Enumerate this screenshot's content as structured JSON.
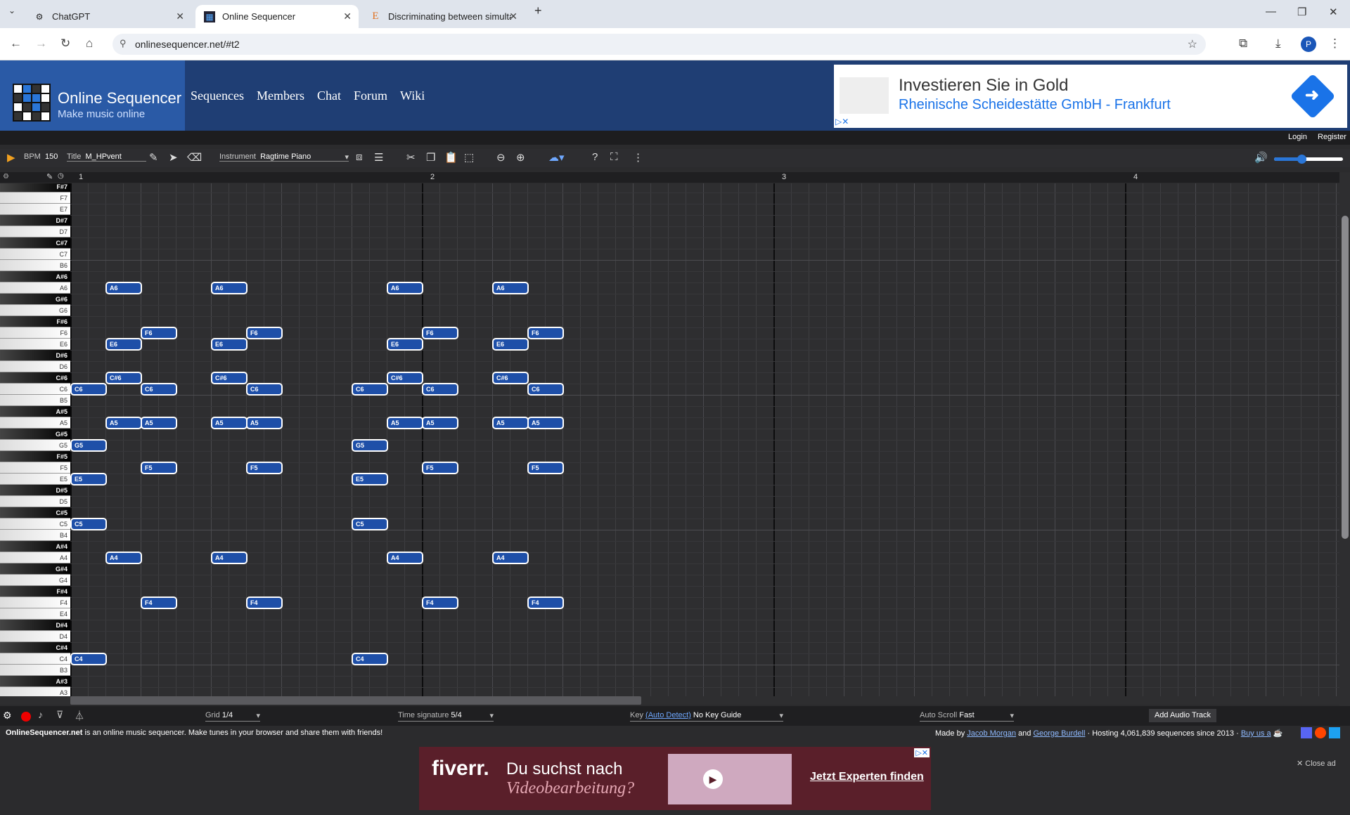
{
  "browser": {
    "tabs": [
      {
        "title": "ChatGPT",
        "icon": "chatgpt-icon"
      },
      {
        "title": "Online Sequencer",
        "icon": "sequencer-icon"
      },
      {
        "title": "Discriminating between simulta",
        "icon": "e-icon"
      }
    ],
    "url": "onlinesequencer.net/#t2",
    "profile_initial": "P"
  },
  "site": {
    "title": "Online Sequencer",
    "subtitle": "Make music online",
    "nav": [
      "Sequences",
      "Members",
      "Chat",
      "Forum",
      "Wiki"
    ],
    "login": "Login",
    "register": "Register"
  },
  "ad_top": {
    "line1": "Investieren Sie in Gold",
    "line2": "Rheinische Scheidestätte GmbH - Frankfurt"
  },
  "toolbar": {
    "bpm_label": "BPM",
    "bpm_value": "150",
    "title_label": "Title",
    "title_value": "M_HPvent",
    "instrument_label": "Instrument",
    "instrument_value": "Ragtime Piano",
    "volume": 0.4
  },
  "ruler": {
    "bars": [
      "1",
      "2",
      "3",
      "4"
    ]
  },
  "keys": [
    "F#7",
    "F7",
    "E7",
    "D#7",
    "D7",
    "C#7",
    "C7",
    "B6",
    "A#6",
    "A6",
    "G#6",
    "G6",
    "F#6",
    "F6",
    "E6",
    "D#6",
    "D6",
    "C#6",
    "C6",
    "B5",
    "A#5",
    "A5",
    "G#5",
    "G5",
    "F#5",
    "F5",
    "E5",
    "D#5",
    "D5",
    "C#5",
    "C5",
    "B4",
    "A#4",
    "A4",
    "G#4",
    "G4",
    "F#4",
    "F4",
    "E4",
    "D#4",
    "D4",
    "C#4",
    "C4",
    "B3",
    "A#3",
    "A3"
  ],
  "notes": [
    {
      "pitch": "C6",
      "time": 0
    },
    {
      "pitch": "G5",
      "time": 0
    },
    {
      "pitch": "E5",
      "time": 0
    },
    {
      "pitch": "C5",
      "time": 0
    },
    {
      "pitch": "C4",
      "time": 0
    },
    {
      "pitch": "A6",
      "time": 2
    },
    {
      "pitch": "E6",
      "time": 2
    },
    {
      "pitch": "C#6",
      "time": 2
    },
    {
      "pitch": "A5",
      "time": 2
    },
    {
      "pitch": "A4",
      "time": 2
    },
    {
      "pitch": "F6",
      "time": 4
    },
    {
      "pitch": "C6",
      "time": 4
    },
    {
      "pitch": "A5",
      "time": 4
    },
    {
      "pitch": "F5",
      "time": 4
    },
    {
      "pitch": "F4",
      "time": 4
    },
    {
      "pitch": "A6",
      "time": 8
    },
    {
      "pitch": "E6",
      "time": 8
    },
    {
      "pitch": "C#6",
      "time": 8
    },
    {
      "pitch": "A5",
      "time": 8
    },
    {
      "pitch": "A4",
      "time": 8
    },
    {
      "pitch": "F6",
      "time": 10
    },
    {
      "pitch": "C6",
      "time": 10
    },
    {
      "pitch": "A5",
      "time": 10
    },
    {
      "pitch": "F5",
      "time": 10
    },
    {
      "pitch": "F4",
      "time": 10
    },
    {
      "pitch": "C6",
      "time": 16
    },
    {
      "pitch": "G5",
      "time": 16
    },
    {
      "pitch": "E5",
      "time": 16
    },
    {
      "pitch": "C5",
      "time": 16
    },
    {
      "pitch": "C4",
      "time": 16
    },
    {
      "pitch": "A6",
      "time": 18
    },
    {
      "pitch": "E6",
      "time": 18
    },
    {
      "pitch": "C#6",
      "time": 18
    },
    {
      "pitch": "A5",
      "time": 18
    },
    {
      "pitch": "A4",
      "time": 18
    },
    {
      "pitch": "F6",
      "time": 20
    },
    {
      "pitch": "C6",
      "time": 20
    },
    {
      "pitch": "A5",
      "time": 20
    },
    {
      "pitch": "F5",
      "time": 20
    },
    {
      "pitch": "F4",
      "time": 20
    },
    {
      "pitch": "A6",
      "time": 24
    },
    {
      "pitch": "E6",
      "time": 24
    },
    {
      "pitch": "C#6",
      "time": 24
    },
    {
      "pitch": "A5",
      "time": 24
    },
    {
      "pitch": "A4",
      "time": 24
    },
    {
      "pitch": "F6",
      "time": 26
    },
    {
      "pitch": "C6",
      "time": 26
    },
    {
      "pitch": "A5",
      "time": 26
    },
    {
      "pitch": "F5",
      "time": 26
    },
    {
      "pitch": "F4",
      "time": 26
    }
  ],
  "bottombar": {
    "grid_label": "Grid",
    "grid_value": "1/4",
    "timesig_label": "Time signature",
    "timesig_value": "5/4",
    "key_label": "Key",
    "key_auto": "(Auto Detect)",
    "key_value": "No Key Guide",
    "autoscroll_label": "Auto Scroll",
    "autoscroll_value": "Fast",
    "add_audio": "Add Audio Track"
  },
  "info": {
    "site_name": "OnlineSequencer.net",
    "description": " is an online music sequencer. Make tunes in your browser and share them with friends!",
    "made_by": "Made by ",
    "author1": "Jacob Morgan",
    "and": " and ",
    "author2": "George Burdell",
    "hosting": " · Hosting 4,061,839 sequences since 2013 · ",
    "buy": "Buy us a"
  },
  "ad_bottom": {
    "brand": "fiverr.",
    "line1": "Du suchst nach",
    "line2": "Videobearbeitung?",
    "cta": "Jetzt Experten finden",
    "close": "✕ Close ad"
  }
}
